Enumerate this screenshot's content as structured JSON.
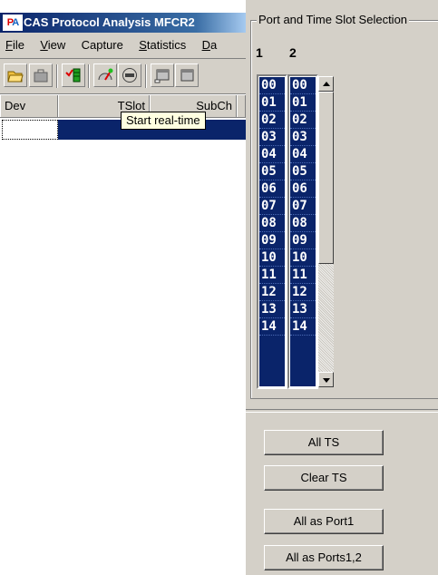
{
  "window": {
    "title": "CAS Protocol Analysis MFCR2",
    "icon_text": "PA"
  },
  "menu": [
    "File",
    "View",
    "Capture",
    "Statistics",
    "Da"
  ],
  "menu_mnemonics": [
    "F",
    "V",
    "",
    "S",
    "D"
  ],
  "toolbar": {
    "icons": [
      "open-folder-icon",
      "briefcase-icon",
      "checklist-icon",
      "gauge-icon",
      "stop-icon",
      "window-icon",
      "window2-icon"
    ]
  },
  "table": {
    "headers": [
      "Dev",
      "TSlot",
      "SubCh"
    ]
  },
  "tooltip": "Start real-time",
  "panel": {
    "group_title": "Port and Time Slot Selection",
    "col_headers": [
      "1",
      "2"
    ],
    "port1_items": [
      "00",
      "01",
      "02",
      "03",
      "04",
      "05",
      "06",
      "07",
      "08",
      "09",
      "10",
      "11",
      "12",
      "13",
      "14"
    ],
    "port2_items": [
      "00",
      "01",
      "02",
      "03",
      "04",
      "05",
      "06",
      "07",
      "08",
      "09",
      "10",
      "11",
      "12",
      "13",
      "14"
    ],
    "buttons": {
      "all_ts": "All TS",
      "clear_ts": "Clear TS",
      "all_port1": "All as Port1",
      "all_ports12": "All as Ports1,2"
    }
  },
  "colors": {
    "selection": "#0a246a",
    "face": "#d4d0c8",
    "tooltip_bg": "#ffffe1"
  }
}
